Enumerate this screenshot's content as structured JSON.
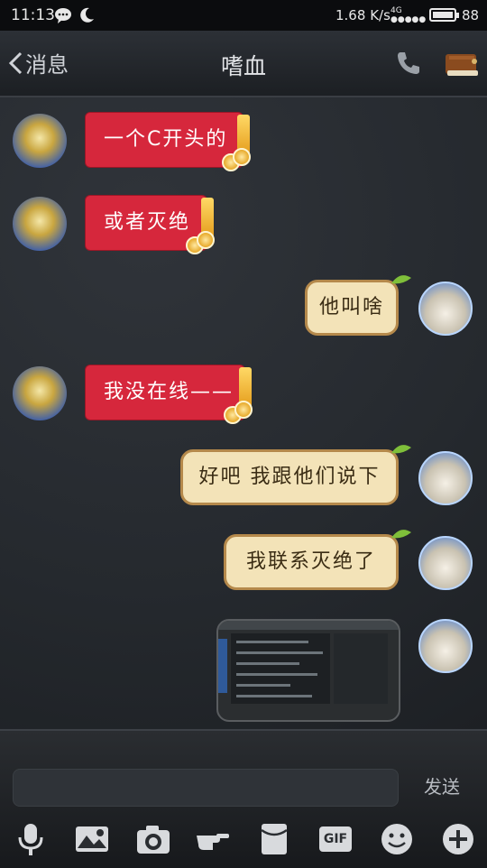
{
  "status_bar": {
    "time": "11:13",
    "speed": "1.68",
    "speed_unit": "K/s",
    "network": "4G",
    "battery": "88"
  },
  "header": {
    "back_label": "消息",
    "title": "嗜血"
  },
  "messages": [
    {
      "side": "left",
      "text": "一个C开头的"
    },
    {
      "side": "left",
      "text": "或者灭绝"
    },
    {
      "side": "right",
      "text": "他叫啥"
    },
    {
      "side": "left",
      "text": "我没在线——"
    },
    {
      "side": "right",
      "text": "好吧  我跟他们说下"
    },
    {
      "side": "right",
      "text": "我联系灭绝了"
    },
    {
      "side": "right",
      "type": "image",
      "text": ""
    }
  ],
  "input": {
    "placeholder": "",
    "send_label": "发送"
  },
  "toolbar": {
    "gif_label": "GIF"
  },
  "colors": {
    "left_bubble": "#d6273c",
    "right_bubble": "#f3e3b8",
    "background": "#262a30"
  }
}
